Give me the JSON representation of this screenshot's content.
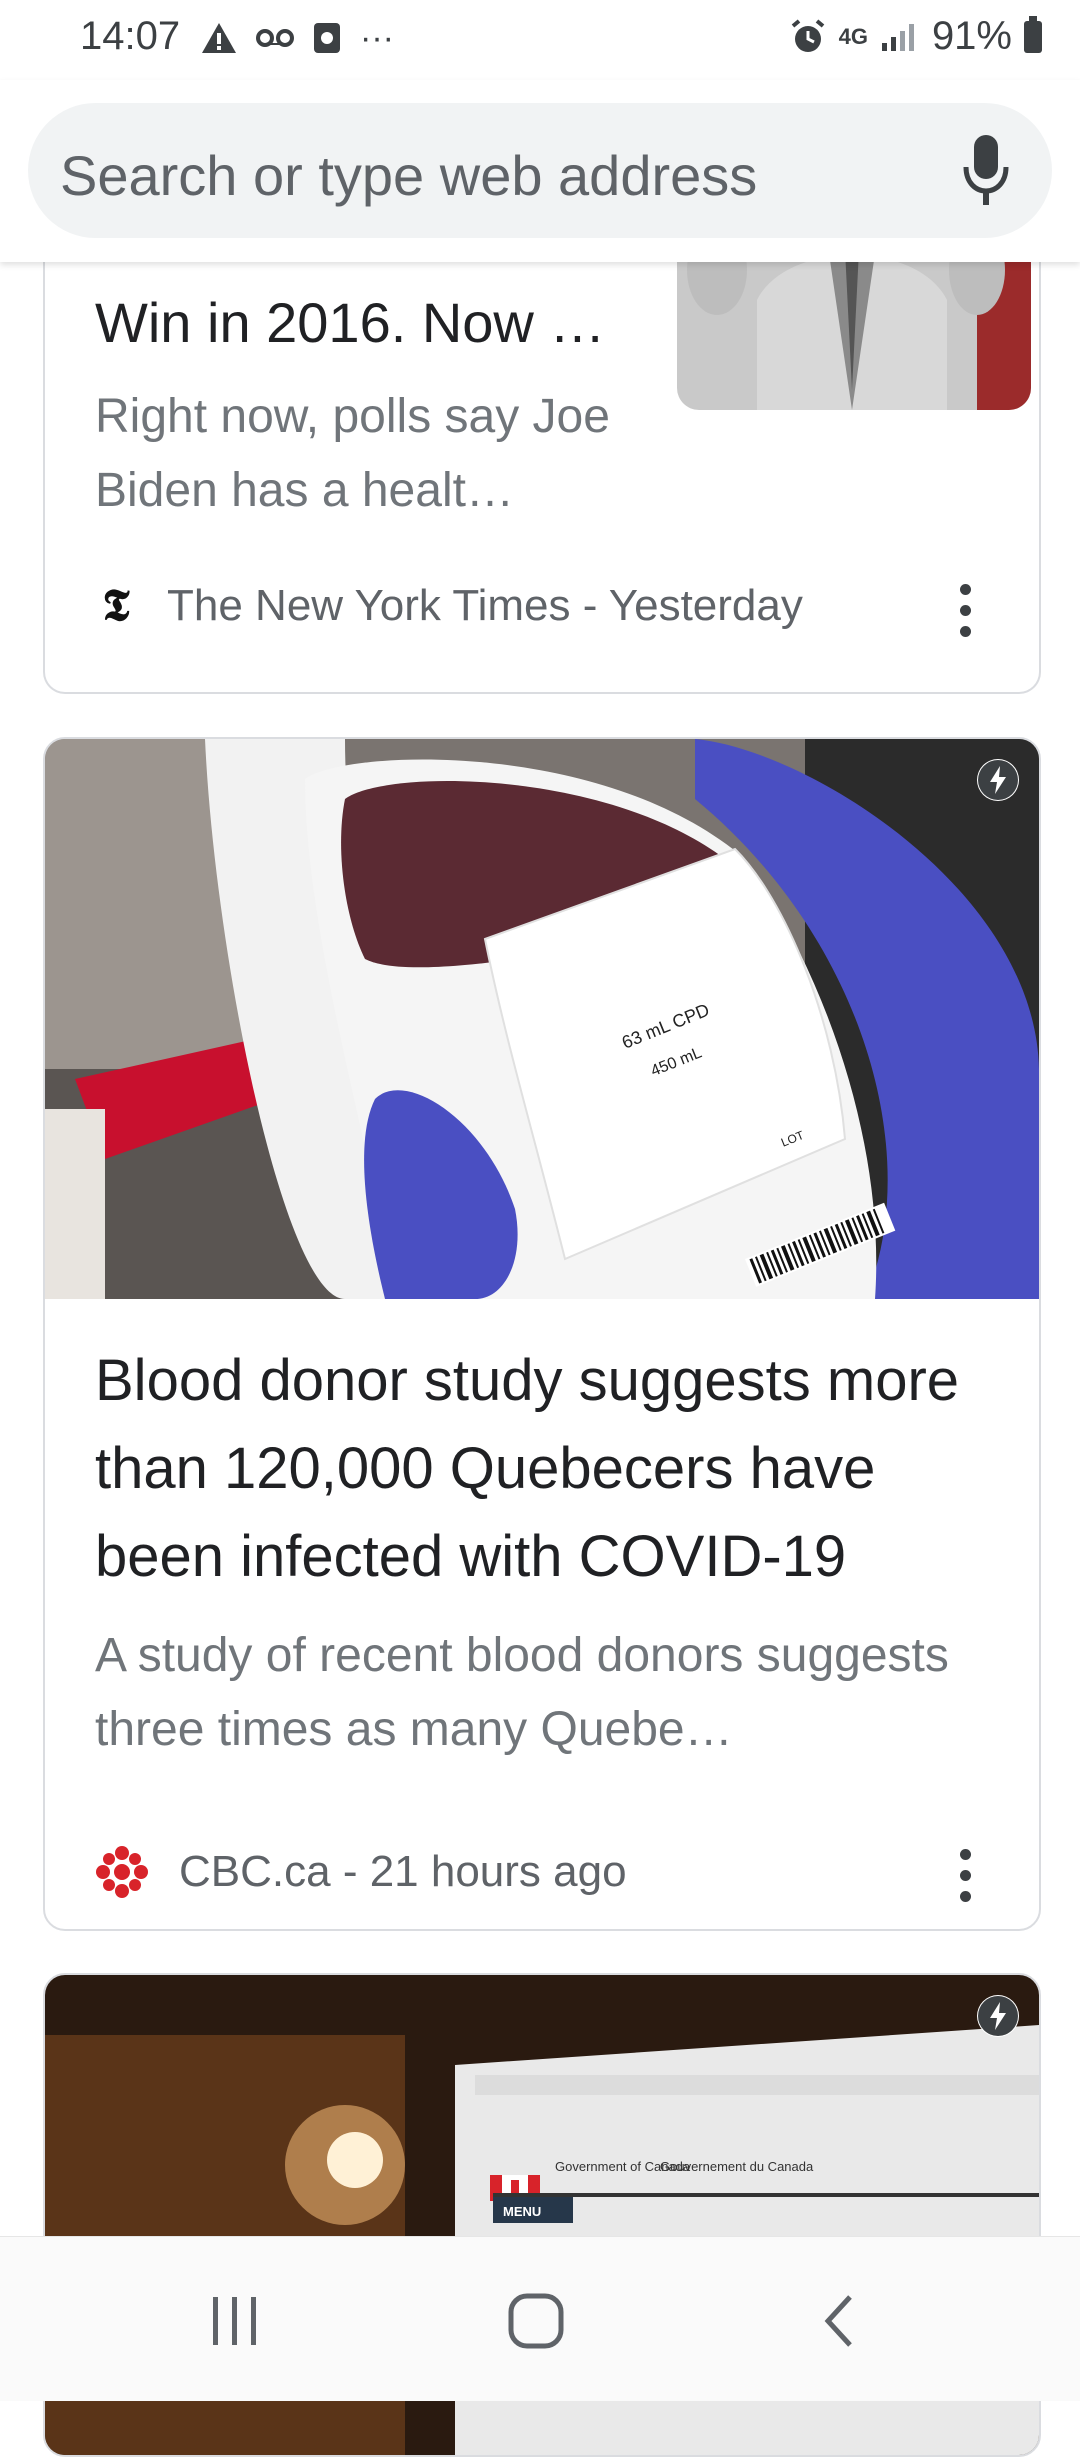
{
  "status_bar": {
    "time": "14:07",
    "left_icons": [
      "warning-icon",
      "voicemail-icon",
      "app-notification-icon",
      "more-notifications-icon"
    ],
    "network": "4G",
    "battery_percent": "91%"
  },
  "search": {
    "placeholder": "Search or type web address"
  },
  "cards": [
    {
      "title": "Win in 2016. Now …",
      "snippet": "Right now, polls say Joe Biden has a healt…",
      "source": "The New York Times - Yesterday"
    },
    {
      "title": "Blood donor study suggests more than 120,000 Quebecers have been infected with COVID-19",
      "snippet": "A study of recent blood donors suggests three times as many Quebe…",
      "source": "CBC.ca - 21 hours ago"
    },
    {
      "image_texts": {
        "gov_en": "Government of Canada",
        "gov_fr": "Gouvernement du Canada",
        "menu": "MENU"
      }
    }
  ],
  "blood_bag_label": {
    "line1": "63 mL CPD",
    "line2": "450 mL",
    "lot": "LOT"
  },
  "nav": [
    "recent-apps",
    "home",
    "back"
  ]
}
